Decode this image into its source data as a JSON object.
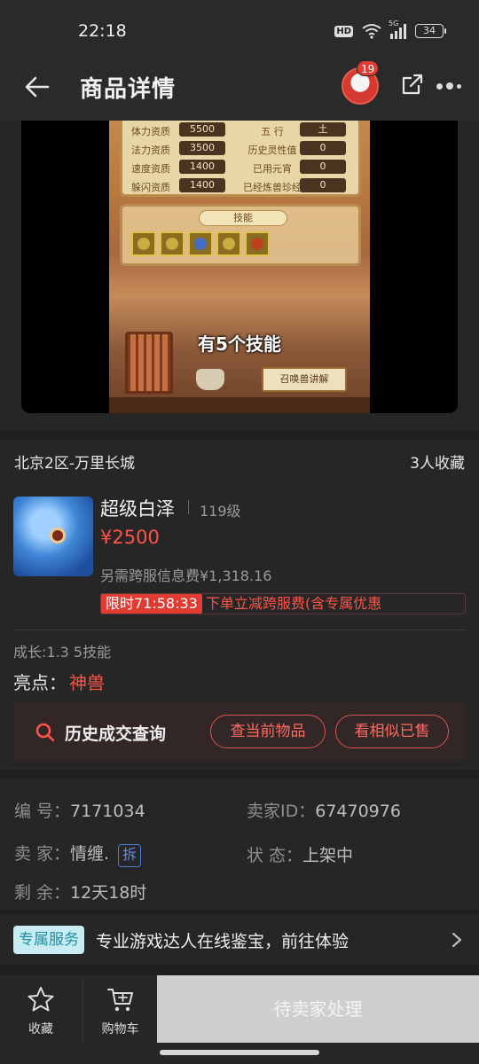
{
  "status_bar": {
    "time": "22:18",
    "hd": "HD",
    "network": "5G",
    "battery": "34"
  },
  "nav": {
    "title": "商品详情",
    "message_count": "19",
    "icons": [
      "back-arrow-icon",
      "share-icon",
      "more-icon"
    ]
  },
  "game_screenshot": {
    "stats": [
      {
        "label": "体力资质",
        "value": "5500",
        "label2": "五  行",
        "value2": "土"
      },
      {
        "label": "法力资质",
        "value": "3500",
        "label2": "历史灵性值",
        "value2": "0"
      },
      {
        "label": "速度资质",
        "value": "1400",
        "label2": "已用元宵",
        "value2": "0"
      },
      {
        "label": "躲闪资质",
        "value": "1400",
        "label2": "已经炼兽珍经",
        "value2": "0"
      }
    ],
    "skills_title": "技能",
    "caption": "有5个技能",
    "sign": "召唤兽讲解"
  },
  "location": {
    "server": "北京2区-万里长城",
    "favorites": "3人收藏"
  },
  "product": {
    "name": "超级白泽",
    "level": "119级",
    "price": "¥2500",
    "cross_fee": "另需跨服信息费¥1,318.16",
    "promo_timer": "限时71:58:33",
    "promo_text": "下单立减跨服费(含专属优惠",
    "growth": "成长:1.3 5技能",
    "highlight_label": "亮点：",
    "highlight_value": "神兽",
    "history_title": "历史成交查询",
    "btn_current": "查当前物品",
    "btn_similar": "看相似已售"
  },
  "info": {
    "id_label": "编  号：",
    "id_value": "7171034",
    "seller_id_label": "卖家ID：",
    "seller_id_value": "67470976",
    "seller_label": "卖  家：",
    "seller_value": "情缠.",
    "chai_badge": "拆",
    "status_label": "状  态：",
    "status_value": "上架中",
    "remain_label": "剩  余：",
    "remain_value": "12天18时"
  },
  "service": {
    "tag": "专属服务",
    "text": "专业游戏达人在线鉴宝，前往体验"
  },
  "bottom": {
    "fav_label": "收藏",
    "cart_label": "购物车",
    "action_label": "待卖家处理"
  }
}
